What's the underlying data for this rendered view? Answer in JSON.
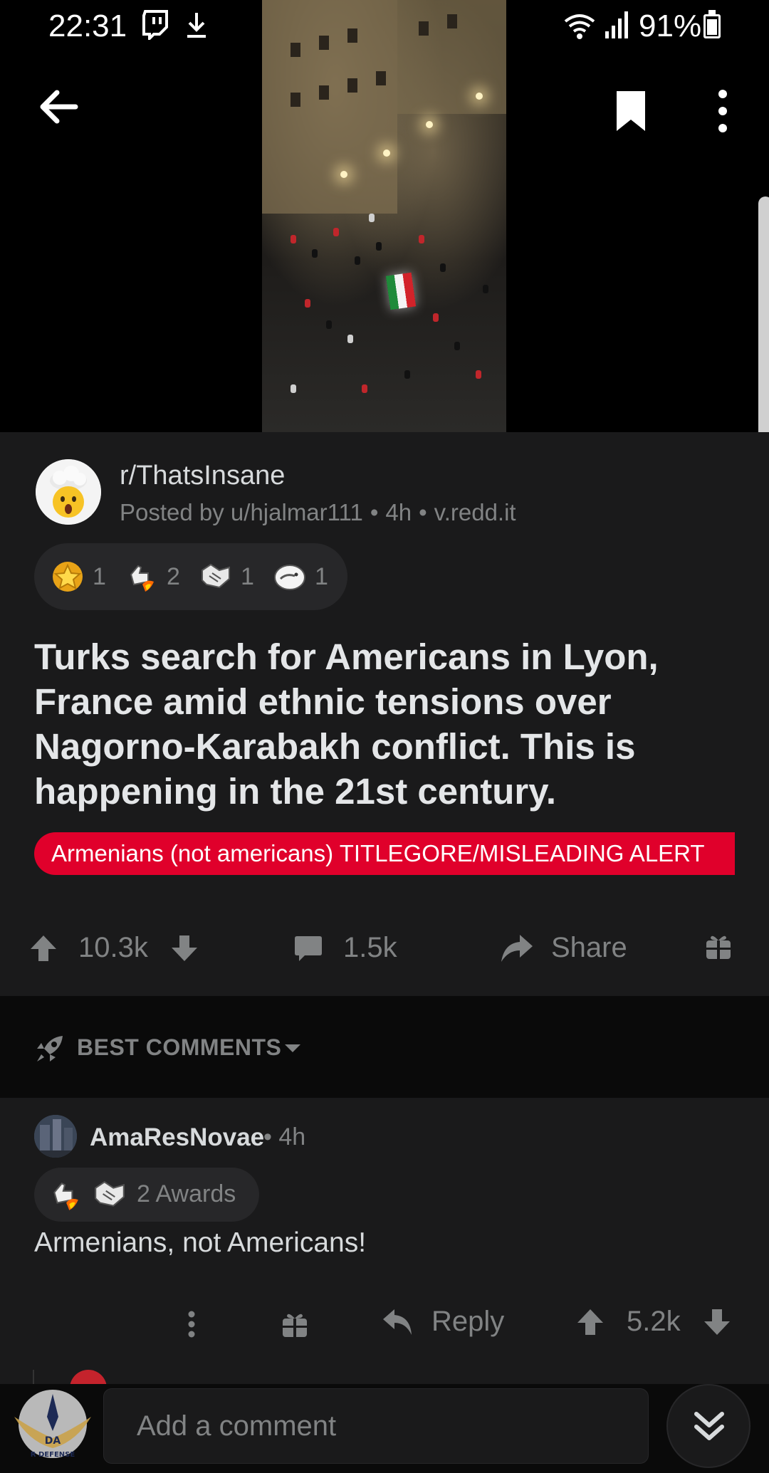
{
  "status_bar": {
    "time": "22:31",
    "battery": "91%"
  },
  "post": {
    "subreddit": "r/ThatsInsane",
    "posted_by": "Posted by u/hjalmar111",
    "age": "4h",
    "domain": "v.redd.it",
    "awards": [
      {
        "icon": "gold-star-award-icon",
        "count": "1"
      },
      {
        "icon": "rocket-like-award-icon",
        "count": "2"
      },
      {
        "icon": "handshake-award-icon",
        "count": "1"
      },
      {
        "icon": "facepalm-award-icon",
        "count": "1"
      }
    ],
    "title": "Turks search for Americans in Lyon, France amid ethnic tensions over Nagorno-Karabakh conflict. This is happening in the 21st century.",
    "flair": "Armenians (not americans) TITLEGORE/MISLEADING ALERT",
    "flair_color": "#e0002b",
    "votes": "10.3k",
    "comments": "1.5k",
    "share_label": "Share"
  },
  "sort": {
    "label": "BEST COMMENTS"
  },
  "comment": {
    "author": "AmaResNovae",
    "age": "4h",
    "awards_label": "2 Awards",
    "body": "Armenians, not Americans!",
    "reply_label": "Reply",
    "votes": "5.2k"
  },
  "bottom": {
    "comment_placeholder": "Add a comment"
  },
  "watermark": {
    "text": "DA",
    "subtext": "R DEFENSE"
  },
  "colors": {
    "background": "#000000",
    "card": "#1a1a1b",
    "muted": "#818384",
    "accent_red": "#e0002b"
  }
}
